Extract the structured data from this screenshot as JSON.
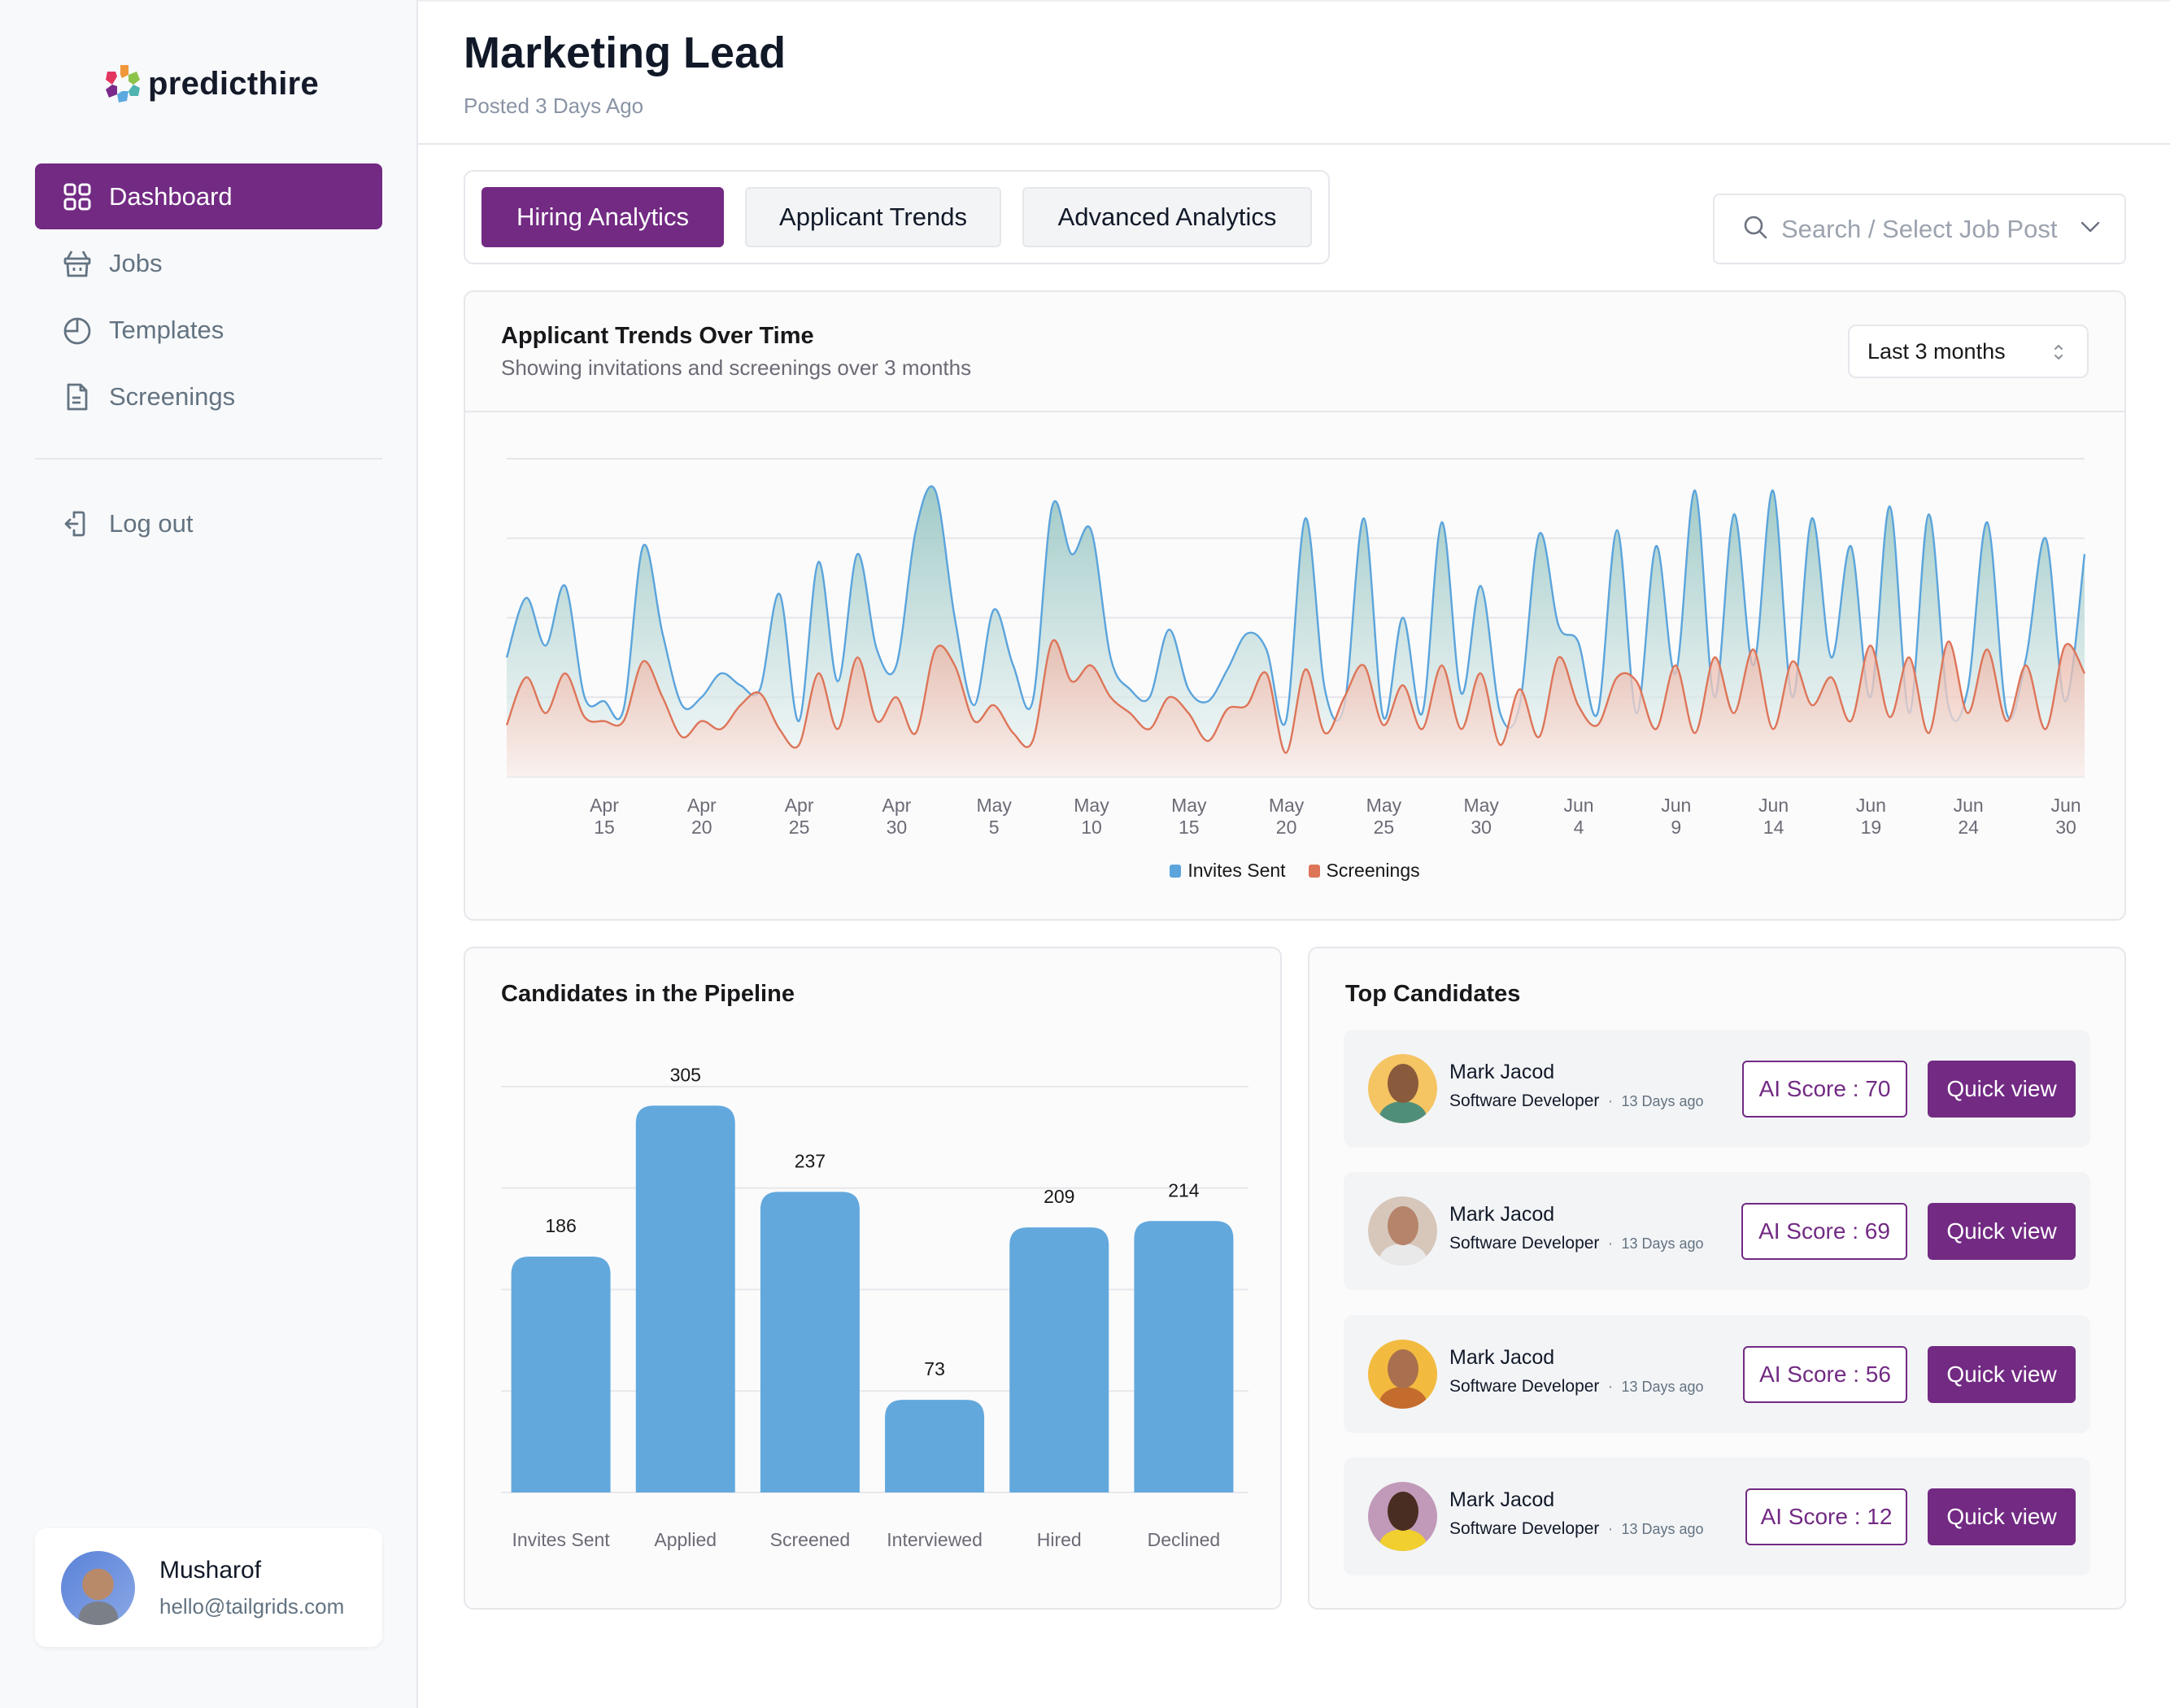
{
  "app": {
    "logo_text": "predicthire"
  },
  "sidebar": {
    "items": [
      {
        "label": "Dashboard",
        "icon": "grid-icon",
        "active": true
      },
      {
        "label": "Jobs",
        "icon": "basket-icon",
        "active": false
      },
      {
        "label": "Templates",
        "icon": "pie-chart-icon",
        "active": false
      },
      {
        "label": "Screenings",
        "icon": "document-icon",
        "active": false
      }
    ],
    "logout_label": "Log out",
    "user": {
      "name": "Musharof",
      "email": "hello@tailgrids.com"
    }
  },
  "header": {
    "title": "Marketing Lead",
    "subtitle": "Posted 3 Days Ago"
  },
  "tabs": [
    {
      "label": "Hiring Analytics",
      "active": true
    },
    {
      "label": "Applicant Trends",
      "active": false
    },
    {
      "label": "Advanced Analytics",
      "active": false
    }
  ],
  "search": {
    "placeholder": "Search / Select Job Post"
  },
  "colors": {
    "brand": "#722a83",
    "invites": "#5ba4dc",
    "screenings": "#dd7559",
    "bar": "#62a8dd"
  },
  "trend_card": {
    "title": "Applicant Trends Over Time",
    "subtitle": "Showing invitations and screenings over 3 months",
    "range_value": "Last 3 months"
  },
  "pipeline_card": {
    "title": "Candidates in the Pipeline"
  },
  "top_candidates": {
    "title": "Top Candidates",
    "items": [
      {
        "name": "Mark Jacod",
        "role": "Software Developer",
        "ago": "13 Days ago",
        "score_label": "AI Score : 70",
        "score": 70,
        "action": "Quick view",
        "avatar_bg": "#f5c463",
        "skin": "#8a5a3c",
        "shirt": "#4f8f7a"
      },
      {
        "name": "Mark Jacod",
        "role": "Software Developer",
        "ago": "13 Days ago",
        "score_label": "AI Score : 69",
        "score": 69,
        "action": "Quick view",
        "avatar_bg": "#d7c7bb",
        "skin": "#b5846a",
        "shirt": "#e9e9ea"
      },
      {
        "name": "Mark Jacod",
        "role": "Software Developer",
        "ago": "13 Days ago",
        "score_label": "AI Score : 56",
        "score": 56,
        "action": "Quick view",
        "avatar_bg": "#f2bb3f",
        "skin": "#a8704e",
        "shirt": "#c46b2e"
      },
      {
        "name": "Mark Jacod",
        "role": "Software Developer",
        "ago": "13 Days ago",
        "score_label": "AI Score : 12",
        "score": 12,
        "action": "Quick view",
        "avatar_bg": "#c09ab8",
        "skin": "#4a2d22",
        "shirt": "#f0cf2e"
      }
    ]
  },
  "chart_data": [
    {
      "type": "area",
      "title": "Applicant Trends Over Time",
      "subtitle": "Showing invitations and screenings over 3 months",
      "xlabel": "",
      "ylabel": "",
      "ylim": [
        0,
        400
      ],
      "grid": true,
      "legend": "bottom-center",
      "x_ticks": [
        [
          "Apr",
          "15"
        ],
        [
          "Apr",
          "20"
        ],
        [
          "Apr",
          "25"
        ],
        [
          "Apr",
          "30"
        ],
        [
          "May",
          "5"
        ],
        [
          "May",
          "10"
        ],
        [
          "May",
          "15"
        ],
        [
          "May",
          "20"
        ],
        [
          "May",
          "25"
        ],
        [
          "May",
          "30"
        ],
        [
          "Jun",
          "4"
        ],
        [
          "Jun",
          "9"
        ],
        [
          "Jun",
          "14"
        ],
        [
          "Jun",
          "19"
        ],
        [
          "Jun",
          "24"
        ],
        [
          "Jun",
          "30"
        ]
      ],
      "x_range": [
        "Apr 10",
        "Jul 1"
      ],
      "series": [
        {
          "name": "Invites Sent",
          "color": "#5ba4dc",
          "values": [
            150,
            225,
            165,
            240,
            100,
            95,
            85,
            290,
            180,
            90,
            100,
            130,
            115,
            110,
            230,
            70,
            270,
            120,
            280,
            160,
            140,
            310,
            360,
            200,
            90,
            210,
            140,
            95,
            340,
            280,
            310,
            150,
            110,
            100,
            185,
            110,
            95,
            135,
            180,
            160,
            70,
            325,
            110,
            90,
            325,
            75,
            200,
            80,
            320,
            105,
            240,
            80,
            90,
            305,
            190,
            170,
            80,
            310,
            80,
            290,
            130,
            360,
            100,
            330,
            140,
            360,
            100,
            325,
            150,
            290,
            100,
            340,
            80,
            330,
            90,
            110,
            320,
            80,
            150,
            300,
            95,
            280
          ]
        },
        {
          "name": "Screenings",
          "color": "#dd7559",
          "values": [
            65,
            125,
            80,
            130,
            75,
            70,
            70,
            145,
            100,
            50,
            70,
            60,
            90,
            105,
            60,
            40,
            130,
            60,
            150,
            70,
            100,
            55,
            160,
            140,
            70,
            90,
            55,
            45,
            170,
            120,
            140,
            100,
            80,
            60,
            100,
            80,
            45,
            85,
            90,
            130,
            30,
            135,
            55,
            100,
            140,
            65,
            115,
            60,
            140,
            60,
            130,
            40,
            110,
            50,
            150,
            90,
            65,
            125,
            120,
            60,
            140,
            55,
            150,
            80,
            160,
            60,
            145,
            90,
            125,
            70,
            165,
            75,
            150,
            55,
            170,
            80,
            160,
            70,
            140,
            60,
            165,
            130
          ]
        }
      ]
    },
    {
      "type": "bar",
      "title": "Candidates in the Pipeline",
      "categories": [
        "Invites Sent",
        "Applied",
        "Screened",
        "Interviewed",
        "Hired",
        "Declined"
      ],
      "values": [
        186,
        305,
        237,
        73,
        209,
        214
      ],
      "value_labels": [
        "186",
        "305",
        "237",
        "73",
        "209",
        "214"
      ],
      "xlabel": "",
      "ylabel": "",
      "ylim": [
        0,
        320
      ],
      "grid": true,
      "color": "#62a8dd"
    }
  ]
}
